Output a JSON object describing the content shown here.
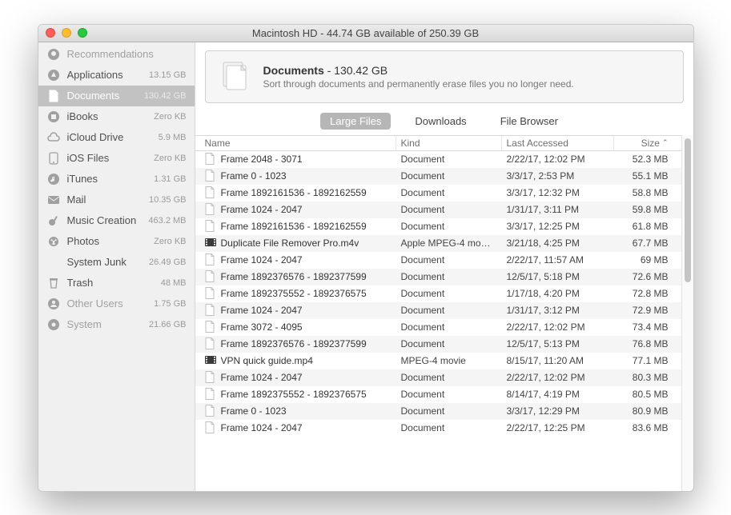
{
  "window": {
    "title": "Macintosh HD - 44.74 GB available of 250.39 GB"
  },
  "sidebar": {
    "items": [
      {
        "label": "Recommendations",
        "size": "",
        "icon": "lightbulb",
        "dim": true
      },
      {
        "label": "Applications",
        "size": "13.15 GB",
        "icon": "app"
      },
      {
        "label": "Documents",
        "size": "130.42 GB",
        "icon": "doc",
        "active": true
      },
      {
        "label": "iBooks",
        "size": "Zero KB",
        "icon": "books"
      },
      {
        "label": "iCloud Drive",
        "size": "5.9 MB",
        "icon": "cloud"
      },
      {
        "label": "iOS Files",
        "size": "Zero KB",
        "icon": "phone"
      },
      {
        "label": "iTunes",
        "size": "1.31 GB",
        "icon": "music"
      },
      {
        "label": "Mail",
        "size": "10.35 GB",
        "icon": "mail"
      },
      {
        "label": "Music Creation",
        "size": "463.2 MB",
        "icon": "guitar"
      },
      {
        "label": "Photos",
        "size": "Zero KB",
        "icon": "photos"
      },
      {
        "label": "System Junk",
        "size": "26.49 GB",
        "icon": "blank"
      },
      {
        "label": "Trash",
        "size": "48 MB",
        "icon": "trash"
      },
      {
        "label": "Other Users",
        "size": "1.75 GB",
        "icon": "users",
        "dim": true
      },
      {
        "label": "System",
        "size": "21.66 GB",
        "icon": "gear",
        "dim": true
      }
    ]
  },
  "header": {
    "title": "Documents",
    "suffix": " - 130.42 GB",
    "subtitle": "Sort through documents and permanently erase files you no longer need."
  },
  "tabs": [
    {
      "label": "Large Files",
      "active": true
    },
    {
      "label": "Downloads"
    },
    {
      "label": "File Browser"
    }
  ],
  "columns": {
    "name": "Name",
    "kind": "Kind",
    "accessed": "Last Accessed",
    "size": "Size"
  },
  "rows": [
    {
      "name": "Frame 2048 - 3071",
      "kind": "Document",
      "accessed": "2/22/17, 12:02 PM",
      "size": "52.3 MB",
      "icon": "doc"
    },
    {
      "name": "Frame 0 - 1023",
      "kind": "Document",
      "accessed": "3/3/17, 2:53 PM",
      "size": "55.1 MB",
      "icon": "doc"
    },
    {
      "name": "Frame 1892161536 - 1892162559",
      "kind": "Document",
      "accessed": "3/3/17, 12:32 PM",
      "size": "58.8 MB",
      "icon": "doc"
    },
    {
      "name": "Frame 1024 - 2047",
      "kind": "Document",
      "accessed": "1/31/17, 3:11 PM",
      "size": "59.8 MB",
      "icon": "doc"
    },
    {
      "name": "Frame 1892161536 - 1892162559",
      "kind": "Document",
      "accessed": "3/3/17, 12:25 PM",
      "size": "61.8 MB",
      "icon": "doc"
    },
    {
      "name": "Duplicate File Remover Pro.m4v",
      "kind": "Apple MPEG-4 mo…",
      "accessed": "3/21/18, 4:25 PM",
      "size": "67.7 MB",
      "icon": "vid"
    },
    {
      "name": "Frame 1024 - 2047",
      "kind": "Document",
      "accessed": "2/22/17, 11:57 AM",
      "size": "69 MB",
      "icon": "doc"
    },
    {
      "name": "Frame 1892376576 - 1892377599",
      "kind": "Document",
      "accessed": "12/5/17, 5:18 PM",
      "size": "72.6 MB",
      "icon": "doc"
    },
    {
      "name": "Frame 1892375552 - 1892376575",
      "kind": "Document",
      "accessed": "1/17/18, 4:20 PM",
      "size": "72.8 MB",
      "icon": "doc"
    },
    {
      "name": "Frame 1024 - 2047",
      "kind": "Document",
      "accessed": "1/31/17, 3:12 PM",
      "size": "72.9 MB",
      "icon": "doc"
    },
    {
      "name": "Frame 3072 - 4095",
      "kind": "Document",
      "accessed": "2/22/17, 12:02 PM",
      "size": "73.4 MB",
      "icon": "doc"
    },
    {
      "name": "Frame 1892376576 - 1892377599",
      "kind": "Document",
      "accessed": "12/5/17, 5:13 PM",
      "size": "76.8 MB",
      "icon": "doc"
    },
    {
      "name": "VPN quick guide.mp4",
      "kind": "MPEG-4 movie",
      "accessed": "8/15/17, 11:20 AM",
      "size": "77.1 MB",
      "icon": "vid"
    },
    {
      "name": "Frame 1024 - 2047",
      "kind": "Document",
      "accessed": "2/22/17, 12:02 PM",
      "size": "80.3 MB",
      "icon": "doc"
    },
    {
      "name": "Frame 1892375552 - 1892376575",
      "kind": "Document",
      "accessed": "8/14/17, 4:19 PM",
      "size": "80.5 MB",
      "icon": "doc"
    },
    {
      "name": "Frame 0 - 1023",
      "kind": "Document",
      "accessed": "3/3/17, 12:29 PM",
      "size": "80.9 MB",
      "icon": "doc"
    },
    {
      "name": "Frame 1024 - 2047",
      "kind": "Document",
      "accessed": "2/22/17, 12:25 PM",
      "size": "83.6 MB",
      "icon": "doc"
    }
  ]
}
